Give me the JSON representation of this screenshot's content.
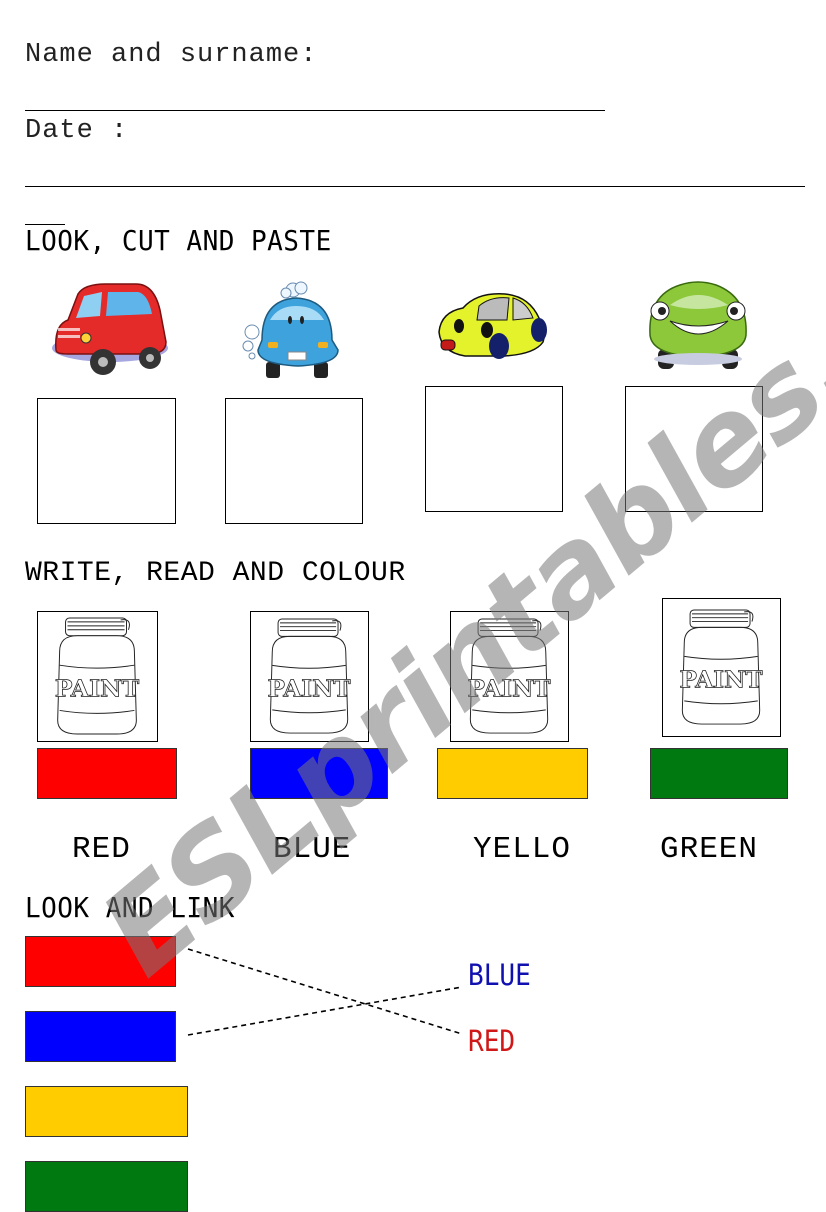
{
  "header": {
    "name_label": "Name and surname:",
    "date_label": "Date :"
  },
  "section_cut_paste": {
    "title": "LOOK, CUT AND PASTE",
    "cars": [
      {
        "icon": "red-car-icon",
        "color": "#e52a2a"
      },
      {
        "icon": "blue-car-icon",
        "color": "#3ea2dc"
      },
      {
        "icon": "yellow-car-icon",
        "color": "#e3f22a"
      },
      {
        "icon": "green-car-icon",
        "color": "#8cc83a"
      }
    ]
  },
  "section_colour": {
    "title": "WRITE, READ AND COLOUR",
    "jar_label": "PAINT",
    "items": [
      {
        "word": "RED",
        "color": "#ff0000"
      },
      {
        "word": "BLUE",
        "color": "#0000ff"
      },
      {
        "word": "YELLO",
        "color": "#ffcc00"
      },
      {
        "word": "GREEN",
        "color": "#007a10"
      }
    ]
  },
  "section_link": {
    "title": "LOOK AND LINK",
    "swatches": [
      {
        "color": "#ff0000"
      },
      {
        "color": "#0000ff"
      },
      {
        "color": "#ffcc00"
      },
      {
        "color": "#007a10"
      }
    ],
    "words": [
      {
        "text": "BLUE",
        "color": "#1010b0"
      },
      {
        "text": "RED",
        "color": "#d01818"
      }
    ]
  },
  "watermark": "ESLprintables.com"
}
